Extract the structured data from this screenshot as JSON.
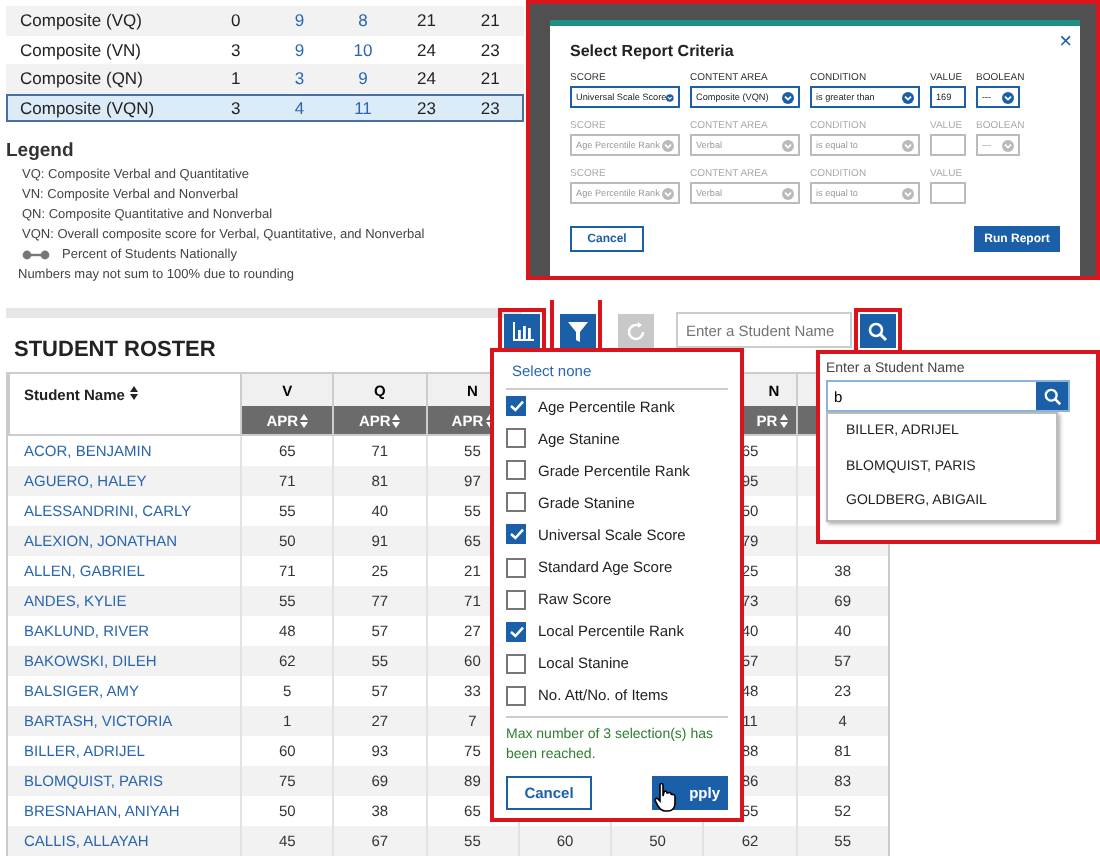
{
  "summary_table": {
    "rows": [
      {
        "label": "Composite (VQ)",
        "values": [
          "0",
          "9",
          "8",
          "21",
          "21"
        ],
        "selected": false
      },
      {
        "label": "Composite (VN)",
        "values": [
          "3",
          "9",
          "10",
          "24",
          "23"
        ],
        "selected": false
      },
      {
        "label": "Composite (QN)",
        "values": [
          "1",
          "3",
          "9",
          "24",
          "21"
        ],
        "selected": false
      },
      {
        "label": "Composite (VQN)",
        "values": [
          "3",
          "4",
          "11",
          "23",
          "23"
        ],
        "selected": true
      }
    ]
  },
  "legend": {
    "title": "Legend",
    "items": [
      {
        "kind": "text",
        "text": "VQ: Composite Verbal and Quantitative"
      },
      {
        "kind": "text",
        "text": "VN: Composite Verbal and Nonverbal"
      },
      {
        "kind": "text",
        "text": "QN: Composite Quantitative and Nonverbal"
      },
      {
        "kind": "text",
        "text": "VQN: Overall composite score for Verbal, Quantitative, and Nonverbal"
      },
      {
        "kind": "line",
        "text": "Percent of Students Nationally"
      },
      {
        "kind": "note",
        "text": "Numbers may not sum to 100% due to rounding"
      }
    ]
  },
  "report_criteria_dialog": {
    "title": "Select Report Criteria",
    "close": "×",
    "rows": [
      {
        "disabled": false,
        "fields": [
          {
            "label": "SCORE",
            "value": "Universal Scale Score",
            "kind": "select"
          },
          {
            "label": "CONTENT AREA",
            "value": "Composite (VQN)",
            "kind": "select"
          },
          {
            "label": "CONDITION",
            "value": "is greater than",
            "kind": "select"
          },
          {
            "label": "VALUE",
            "value": "169",
            "kind": "input"
          },
          {
            "label": "BOOLEAN",
            "value": "---",
            "kind": "small_select"
          }
        ]
      },
      {
        "disabled": true,
        "fields": [
          {
            "label": "SCORE",
            "value": "Age Percentile Rank",
            "kind": "select"
          },
          {
            "label": "CONTENT AREA",
            "value": "Verbal",
            "kind": "select"
          },
          {
            "label": "CONDITION",
            "value": "is equal to",
            "kind": "select"
          },
          {
            "label": "VALUE",
            "kind": "input"
          },
          {
            "label": "BOOLEAN",
            "value": "---",
            "kind": "small_select"
          }
        ]
      },
      {
        "disabled": true,
        "fields": [
          {
            "label": "SCORE",
            "value": "Age Percentile Rank",
            "kind": "select"
          },
          {
            "label": "CONTENT AREA",
            "value": "Verbal",
            "kind": "select"
          },
          {
            "label": "CONDITION",
            "value": "is equal to",
            "kind": "select"
          },
          {
            "label": "VALUE",
            "kind": "input"
          }
        ]
      }
    ],
    "cancel": "Cancel",
    "run": "Run Report"
  },
  "roster": {
    "title": "STUDENT ROSTER",
    "name_column": "Student Name",
    "columns": [
      {
        "label": "V",
        "sub": "APR"
      },
      {
        "label": "Q",
        "sub": "APR"
      },
      {
        "label": "N",
        "sub": "APR"
      },
      {},
      {},
      {
        "label": "N",
        "sub": "PR"
      },
      {}
    ],
    "rows": [
      {
        "name": "ACOR, BENJAMIN",
        "cells": {
          "column_1": "65",
          "column_2": "71",
          "column_3": "55",
          "column_6": "65"
        }
      },
      {
        "name": "AGUERO, HALEY",
        "cells": {
          "column_1": "71",
          "column_2": "81",
          "column_3": "97",
          "column_6": "95"
        }
      },
      {
        "name": "ALESSANDRINI, CARLY",
        "cells": {
          "column_1": "55",
          "column_2": "40",
          "column_3": "55",
          "column_6": "50"
        }
      },
      {
        "name": "ALEXION, JONATHAN",
        "cells": {
          "column_1": "50",
          "column_2": "91",
          "column_3": "65",
          "column_6": "79"
        }
      },
      {
        "name": "ALLEN, GABRIEL",
        "cells": {
          "column_1": "71",
          "column_2": "25",
          "column_3": "21",
          "column_6": "25",
          "column_7": "38"
        }
      },
      {
        "name": "ANDES, KYLIE",
        "cells": {
          "column_1": "55",
          "column_2": "77",
          "column_3": "71",
          "column_6": "73",
          "column_7": "69"
        }
      },
      {
        "name": "BAKLUND, RIVER",
        "cells": {
          "column_1": "48",
          "column_2": "57",
          "column_3": "27",
          "column_6": "40",
          "column_7": "40"
        }
      },
      {
        "name": "BAKOWSKI, DILEH",
        "cells": {
          "column_1": "62",
          "column_2": "55",
          "column_3": "60",
          "column_6": "57",
          "column_7": "57"
        }
      },
      {
        "name": "BALSIGER, AMY",
        "cells": {
          "column_1": "5",
          "column_2": "57",
          "column_3": "33",
          "column_6": "48",
          "column_7": "23"
        }
      },
      {
        "name": "BARTASH, VICTORIA",
        "cells": {
          "column_1": "1",
          "column_2": "27",
          "column_3": "7",
          "column_6": "11",
          "column_7": "4"
        }
      },
      {
        "name": "BILLER, ADRIJEL",
        "cells": {
          "column_1": "60",
          "column_2": "93",
          "column_3": "75",
          "column_6": "88",
          "column_7": "81"
        }
      },
      {
        "name": "BLOMQUIST, PARIS",
        "cells": {
          "column_1": "75",
          "column_2": "69",
          "column_3": "89",
          "column_6": "86",
          "column_7": "83"
        }
      },
      {
        "name": "BRESNAHAN, ANIYAH",
        "cells": {
          "column_1": "50",
          "column_2": "38",
          "column_3": "65",
          "column_6": "55",
          "column_7": "52"
        }
      },
      {
        "name": "CALLIS, ALLAYAH",
        "cells": {
          "column_1": "45",
          "column_2": "67",
          "column_3": "55",
          "column_4": "60",
          "column_5": "50",
          "column_6": "62",
          "column_7": "55"
        }
      }
    ]
  },
  "toolbar": {
    "search_placeholder": "Enter a Student Name"
  },
  "score_menu": {
    "select_none": "Select none",
    "options": [
      {
        "label": "Age Percentile Rank",
        "checked": true
      },
      {
        "label": "Age Stanine",
        "checked": false
      },
      {
        "label": "Grade Percentile Rank",
        "checked": false
      },
      {
        "label": "Grade Stanine",
        "checked": false
      },
      {
        "label": "Universal Scale Score",
        "checked": true
      },
      {
        "label": "Standard Age Score",
        "checked": false
      },
      {
        "label": "Raw Score",
        "checked": false
      },
      {
        "label": "Local Percentile Rank",
        "checked": true
      },
      {
        "label": "Local Stanine",
        "checked": false
      },
      {
        "label": "No. Att/No. of Items",
        "checked": false
      }
    ],
    "message": "Max number of 3 selection(s) has been reached.",
    "cancel": "Cancel",
    "apply": "pply"
  },
  "search_popup": {
    "label": "Enter a Student Name",
    "value": "b",
    "suggestions": [
      "BILLER, ADRIJEL",
      "BLOMQUIST, PARIS",
      "GOLDBERG, ABIGAIL"
    ]
  }
}
